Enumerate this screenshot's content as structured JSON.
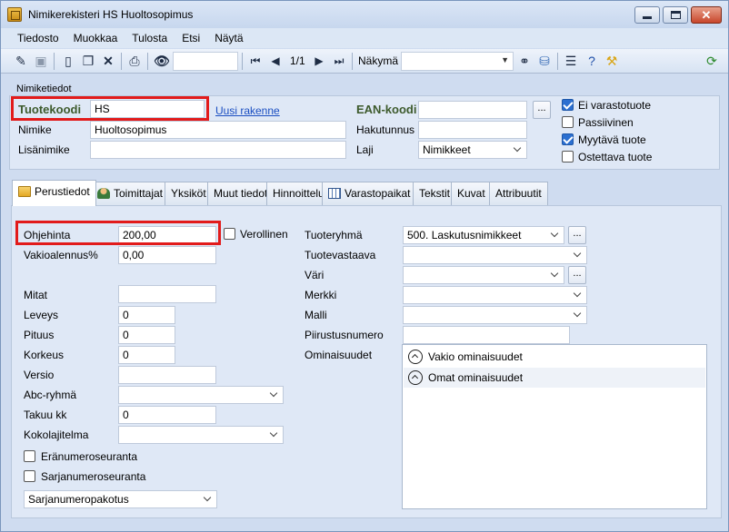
{
  "window": {
    "title": "Nimikerekisteri HS Huoltosopimus"
  },
  "menu": [
    "Tiedosto",
    "Muokkaa",
    "Tulosta",
    "Etsi",
    "Näytä"
  ],
  "toolbar": {
    "page_indicator": "1/1",
    "view_label": "Näkymä",
    "view_value": ""
  },
  "header": {
    "section_title": "Nimiketiedot",
    "code_label": "Tuotekoodi",
    "code_value": "HS",
    "new_structure_link": "Uusi rakenne",
    "name_label": "Nimike",
    "name_value": "Huoltosopimus",
    "extra_name_label": "Lisänimike",
    "extra_name_value": "",
    "ean_label": "EAN-koodi",
    "ean_value": "",
    "search_name_label": "Hakutunnus",
    "search_name_value": "",
    "type_label": "Laji",
    "type_value": "Nimikkeet",
    "ellipsis": "...",
    "checkboxes": [
      {
        "label": "Ei varastotuote",
        "checked": true
      },
      {
        "label": "Passiivinen",
        "checked": false
      },
      {
        "label": "Myytävä tuote",
        "checked": true
      },
      {
        "label": "Ostettava tuote",
        "checked": false
      }
    ]
  },
  "tabs": [
    "Perustiedot",
    "Toimittajat",
    "Yksiköt",
    "Muut tiedot",
    "Hinnoittelu",
    "Varastopaikat",
    "Tekstit",
    "Kuvat",
    "Attribuutit"
  ],
  "basic": {
    "list_price_label": "Ohjehinta",
    "list_price_value": "200,00",
    "taxable_label": "Verollinen",
    "default_discount_label": "Vakioalennus%",
    "default_discount_value": "0,00",
    "dimensions_label": "Mitat",
    "dimensions_value": "",
    "width_label": "Leveys",
    "width_value": "0",
    "length_label": "Pituus",
    "length_value": "0",
    "height_label": "Korkeus",
    "height_value": "0",
    "version_label": "Versio",
    "version_value": "",
    "abc_label": "Abc-ryhmä",
    "abc_value": "",
    "warranty_label": "Takuu kk",
    "warranty_value": "0",
    "size_range_label": "Kokolajitelma",
    "size_range_value": "",
    "batch_tracking_label": "Eränumeroseuranta",
    "serial_tracking_label": "Sarjanumeroseuranta",
    "serial_packing_value": "Sarjanumeropakotus",
    "product_group_label": "Tuoteryhmä",
    "product_group_value": "500. Laskutusnimikkeet",
    "responsible_label": "Tuotevastaava",
    "responsible_value": "",
    "color_label": "Väri",
    "color_value": "",
    "brand_label": "Merkki",
    "brand_value": "",
    "model_label": "Malli",
    "model_value": "",
    "drawing_label": "Piirustusnumero",
    "drawing_value": "",
    "properties_label": "Ominaisuudet",
    "properties": [
      "Vakio ominaisuudet",
      "Omat ominaisuudet"
    ]
  },
  "colors": {
    "highlight": "#e21b1b",
    "link": "#1a4ec2",
    "code_label": "#3d5a2c"
  }
}
